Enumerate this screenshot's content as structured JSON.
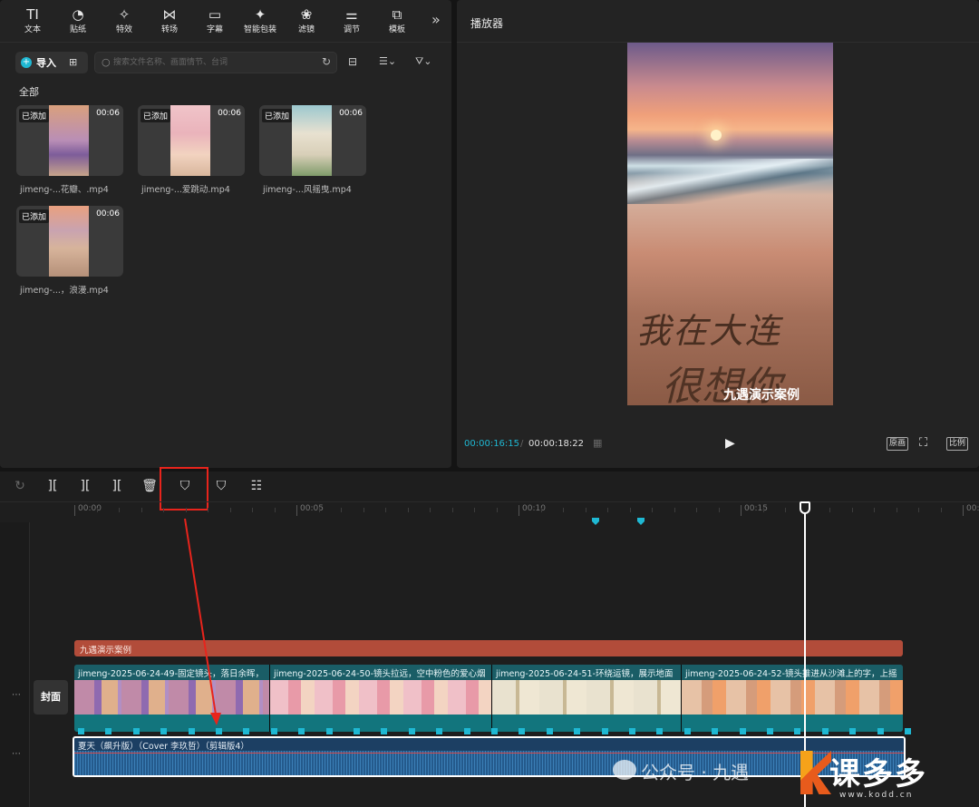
{
  "toolbar": {
    "items": [
      {
        "label": "文本",
        "icon": "text-icon",
        "glyph": "TI"
      },
      {
        "label": "贴纸",
        "icon": "sticker-icon",
        "glyph": "◔"
      },
      {
        "label": "特效",
        "icon": "effects-icon",
        "glyph": "✧"
      },
      {
        "label": "转场",
        "icon": "transition-icon",
        "glyph": "⋈"
      },
      {
        "label": "字幕",
        "icon": "subtitle-icon",
        "glyph": "▭"
      },
      {
        "label": "智能包装",
        "icon": "smart-package-icon",
        "glyph": "✦"
      },
      {
        "label": "滤镜",
        "icon": "filter-icon",
        "glyph": "❀"
      },
      {
        "label": "调节",
        "icon": "adjust-icon",
        "glyph": "⚌"
      },
      {
        "label": "模板",
        "icon": "template-icon",
        "glyph": "⧉"
      }
    ],
    "more": "»"
  },
  "media": {
    "import_label": "导入",
    "search_placeholder": "搜索文件名称、画面情节、台词",
    "all_label": "全部",
    "clips": [
      {
        "badge": "已添加",
        "duration": "00:06",
        "name": "jimeng-...花瓣、.mp4"
      },
      {
        "badge": "已添加",
        "duration": "00:06",
        "name": "jimeng-...爱跳动.mp4"
      },
      {
        "badge": "已添加",
        "duration": "00:06",
        "name": "jimeng-...风摇曳.mp4"
      },
      {
        "badge": "已添加",
        "duration": "00:06",
        "name": "jimeng-...，浪漫.mp4"
      }
    ]
  },
  "player": {
    "title": "播放器",
    "video_text_line1": "我在大连",
    "video_text_line2": "很想你",
    "video_caption": "九遇演示案例",
    "time_current": "00:00:16:15",
    "time_sep": "/",
    "time_total": "00:00:18:22",
    "btn_original": "原画",
    "btn_ratio": "比例"
  },
  "timeline": {
    "ruler": [
      "00:00",
      "00:05",
      "00:10",
      "00:15",
      "00:2"
    ],
    "text_track_label": "九遇演示案例",
    "cover_label": "封面",
    "video_segments": [
      {
        "label": "jimeng-2025-06-24-49-固定镜头，落日余晖，"
      },
      {
        "label": "jimeng-2025-06-24-50-镜头拉远，空中粉色的爱心烟"
      },
      {
        "label": "jimeng-2025-06-24-51-环绕运镜，展示地面"
      },
      {
        "label": "jimeng-2025-06-24-52-镜头推进从沙滩上的字，上摇"
      }
    ],
    "audio_label": "夏天（飙升版）（Cover 李玖哲）（剪辑版4）"
  },
  "watermark": {
    "text": "公众号 · 九遇",
    "brand": "课多多",
    "url": "www.kodd.cn"
  },
  "colors": {
    "accent": "#1fb8d3",
    "highlight": "#e8241c",
    "text_track": "#b24c3a",
    "video_track": "#0f6a73",
    "audio_track": "#1c3f63"
  }
}
